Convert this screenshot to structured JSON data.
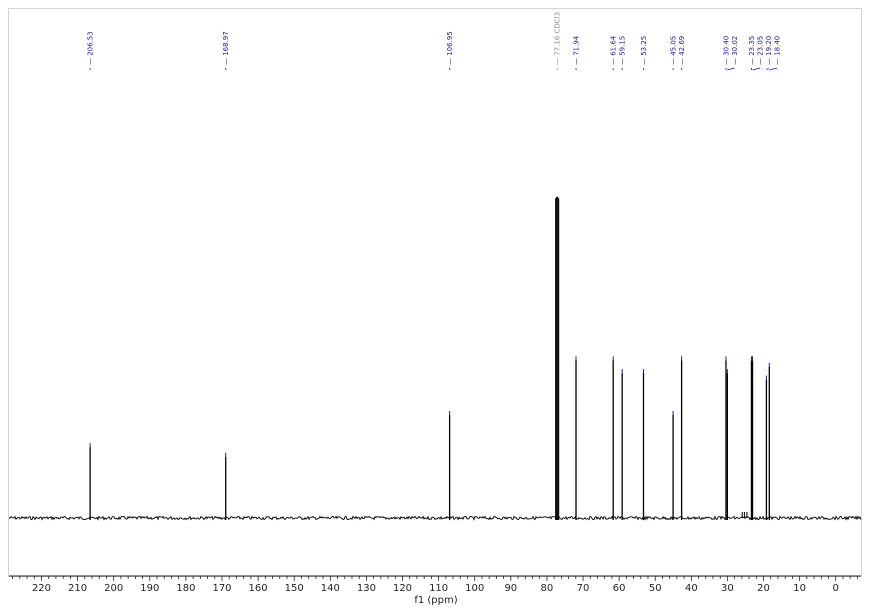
{
  "chart_data": {
    "type": "line",
    "xlabel": "f1 (ppm)",
    "xlim": [
      229,
      -7
    ],
    "x_reversed": true,
    "x_ticks": [
      220,
      210,
      200,
      190,
      180,
      170,
      160,
      150,
      140,
      130,
      120,
      110,
      100,
      90,
      80,
      70,
      60,
      50,
      40,
      30,
      20,
      10,
      0
    ],
    "grid": false,
    "baseline_relative": 0.0,
    "peaks": [
      {
        "ppm": 206.53,
        "label": "206.53",
        "height": 0.22
      },
      {
        "ppm": 168.97,
        "label": "168.97",
        "height": 0.19
      },
      {
        "ppm": 106.95,
        "label": "106.95",
        "height": 0.32
      },
      {
        "ppm": 77.16,
        "label": "77.16 CDCl3",
        "height": 1.0,
        "solvent": true
      },
      {
        "ppm": 71.94,
        "label": "71.94",
        "height": 0.49
      },
      {
        "ppm": 61.64,
        "label": "61.64",
        "height": 0.49
      },
      {
        "ppm": 59.15,
        "label": "59.15",
        "height": 0.45
      },
      {
        "ppm": 53.25,
        "label": "53.25",
        "height": 0.45
      },
      {
        "ppm": 45.05,
        "label": "45.05",
        "height": 0.32
      },
      {
        "ppm": 42.69,
        "label": "42.69",
        "height": 0.49
      },
      {
        "ppm": 30.4,
        "label": "30.40",
        "height": 0.49
      },
      {
        "ppm": 30.02,
        "label": "30.02",
        "height": 0.45
      },
      {
        "ppm": 23.35,
        "label": "23.35",
        "height": 0.49
      },
      {
        "ppm": 23.05,
        "label": "23.05",
        "height": 0.49
      },
      {
        "ppm": 19.2,
        "label": "19.20",
        "height": 0.43
      },
      {
        "ppm": 18.4,
        "label": "18.40",
        "height": 0.47
      }
    ]
  },
  "colors": {
    "trace": "#000000",
    "peak_label": "#1a1f9e",
    "solvent_label": "#8a8a8a",
    "axis": "#222222"
  }
}
